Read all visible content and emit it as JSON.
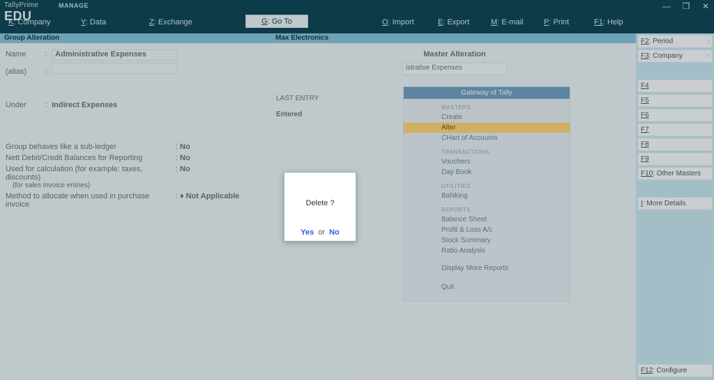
{
  "app": {
    "product": "TallyPrime",
    "edition": "EDU"
  },
  "wincontrols": {
    "min": "—",
    "max": "❐",
    "close": "✕"
  },
  "manage_label": "MANAGE",
  "menubar": {
    "company": {
      "key": "K",
      "label": "Company"
    },
    "data": {
      "key": "Y",
      "label": "Data"
    },
    "exchange": {
      "key": "Z",
      "label": "Exchange"
    },
    "goto": {
      "key": "G",
      "label": "Go To"
    },
    "import": {
      "key": "O",
      "label": "Import"
    },
    "export": {
      "key": "E",
      "label": "Export"
    },
    "email": {
      "key": "M",
      "label": "E-mail"
    },
    "print": {
      "key": "P",
      "label": "Print"
    },
    "help": {
      "key": "F1",
      "label": "Help"
    }
  },
  "strip": {
    "title": "Group Alteration",
    "company": "Max Electronics",
    "close": "✕"
  },
  "group": {
    "name_label": "Name",
    "name_value": "Administrative Expenses",
    "alias_label": "(alias)",
    "alias_value": "",
    "under_label": "Under",
    "under_value": "Indirect Expenses",
    "opt_subLedger_label": "Group behaves like a sub-ledger",
    "opt_subLedger_value": "No",
    "opt_nett_label": "Nett Debit/Credit Balances for Reporting",
    "opt_nett_value": "No",
    "opt_calc_label": "Used for calculation (for example: taxes, discounts)",
    "opt_calc_sub": "(for sales invoice entries)",
    "opt_calc_value": "No",
    "opt_alloc_label": "Method to allocate when used in purchase invoice",
    "opt_alloc_value": "♦ Not Applicable"
  },
  "master": {
    "header": "Master Alteration",
    "input_value": "istrative Expenses",
    "last_entry_label": "LAST ENTRY",
    "entered": "Entered"
  },
  "gateway": {
    "title": "Gateway of Tally",
    "sec_masters": "MASTERS",
    "create": "Create",
    "alter": "Alter",
    "chart": "CHart of Accounts",
    "sec_trans": "TRANSACTIONS",
    "vouchers": "Vouchers",
    "daybook": "Day Book",
    "sec_util": "UTILITIES",
    "banking": "BaNking",
    "sec_reports": "REPORTS",
    "bs": "Balance Sheet",
    "pl": "Profit & Loss A/c",
    "stock": "Stock Summary",
    "ratio": "Ratio Analysis",
    "more": "Display More Reports",
    "quit": "Quit"
  },
  "fpanel": {
    "f2": {
      "key": "F2",
      "label": "Period"
    },
    "f3": {
      "key": "F3",
      "label": "Company"
    },
    "f4": {
      "key": "F4",
      "label": ""
    },
    "f5": {
      "key": "F5",
      "label": ""
    },
    "f6": {
      "key": "F6",
      "label": ""
    },
    "f7": {
      "key": "F7",
      "label": ""
    },
    "f8": {
      "key": "F8",
      "label": ""
    },
    "f9": {
      "key": "F9",
      "label": ""
    },
    "f10": {
      "key": "F10",
      "label": "Other Masters"
    },
    "more": {
      "key": "I",
      "label": "More Details"
    },
    "f12": {
      "key": "F12",
      "label": "Configure"
    }
  },
  "dialog": {
    "message": "Delete ?",
    "yes": "Yes",
    "or": "or",
    "no": "No"
  }
}
